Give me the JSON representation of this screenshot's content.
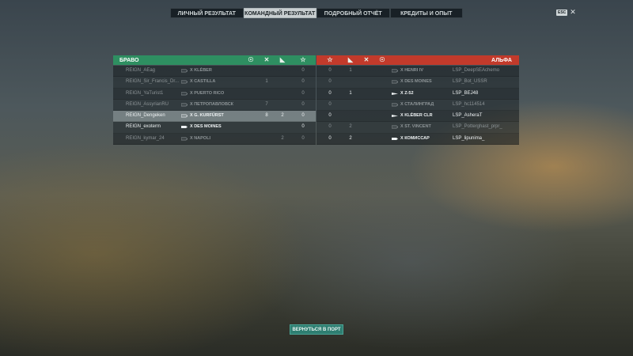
{
  "tabs": [
    "ЛИЧНЫЙ РЕЗУЛЬТАТ",
    "КОМАНДНЫЙ РЕЗУЛЬТАТ",
    "ПОДРОБНЫЙ ОТЧЁТ",
    "КРЕДИТЫ И ОПЫТ"
  ],
  "active_tab": 1,
  "esc_key": "ESC",
  "close_glyph": "✕",
  "teams": {
    "left": {
      "name": "БРАВО",
      "color": "#2e8f61",
      "header_icons": [
        "kills-icon",
        "planes-icon",
        "damage-icon",
        "xp-star-icon"
      ],
      "header_glyphs": [
        "☉",
        "✕",
        "◣",
        "☆"
      ],
      "players": [
        {
          "player": "REIGN_AEag",
          "ship": "X KLÉBER",
          "kills": "",
          "planes": "",
          "damage": "",
          "score": "0",
          "alive": false
        },
        {
          "player": "REIGN_Sir_Francis_Dr...",
          "ship": "X CASTILLA",
          "kills": "1",
          "planes": "",
          "damage": "",
          "score": "0",
          "alive": false
        },
        {
          "player": "REIGN_YaTurist1",
          "ship": "X PUERTO RICO",
          "kills": "",
          "planes": "",
          "damage": "",
          "score": "0",
          "alive": false
        },
        {
          "player": "REIGN_AssyrianRU",
          "ship": "X ПЕТРОПАВЛОВСК",
          "kills": "7",
          "planes": "",
          "damage": "",
          "score": "0",
          "alive": false
        },
        {
          "player": "REIGN_Dengeken",
          "ship": "X G. KURFÜRST",
          "kills": "8",
          "planes": "2",
          "damage": "",
          "score": "0",
          "alive": false,
          "selected": true
        },
        {
          "player": "REIGN_exoterm",
          "ship": "X DES MOINES",
          "kills": "",
          "planes": "",
          "damage": "",
          "score": "0",
          "alive": true
        },
        {
          "player": "REIGN_kymar_24",
          "ship": "X NAPOLI",
          "kills": "",
          "planes": "2",
          "damage": "",
          "score": "0",
          "alive": false
        }
      ]
    },
    "right": {
      "name": "АЛЬФА",
      "color": "#c23a2b",
      "header_icons": [
        "xp-star-icon",
        "damage-icon",
        "planes-icon",
        "kills-icon"
      ],
      "header_glyphs": [
        "☆",
        "◣",
        "✕",
        "☉"
      ],
      "players": [
        {
          "score": "0",
          "damage": "1",
          "planes": "",
          "ship": "X HENRI IV",
          "player": "LSP_DeepSEAchemo",
          "alive": false
        },
        {
          "score": "0",
          "damage": "",
          "planes": "",
          "ship": "X DES MOINES",
          "player": "LSP_Bot_USSR",
          "alive": false
        },
        {
          "score": "0",
          "damage": "1",
          "planes": "",
          "ship": "X Z-52",
          "player": "LSP_BEJ48",
          "alive": true
        },
        {
          "score": "0",
          "damage": "",
          "planes": "",
          "ship": "X СТАЛИНГРАД",
          "player": "LSP_hc114514",
          "alive": false
        },
        {
          "score": "0",
          "damage": "",
          "planes": "",
          "ship": "X KLÉBER CLR",
          "player": "LSP_AsheraT",
          "alive": true
        },
        {
          "score": "0",
          "damage": "2",
          "planes": "",
          "ship": "X ST. VINCENT",
          "player": "LSP_Potterghast_prpr_",
          "alive": false
        },
        {
          "score": "0",
          "damage": "2",
          "planes": "",
          "ship": "X КОМИССАР",
          "player": "LSP_lipunima_",
          "alive": true
        }
      ]
    }
  },
  "back_button": "ВЕРНУТЬСЯ В ПОРТ"
}
